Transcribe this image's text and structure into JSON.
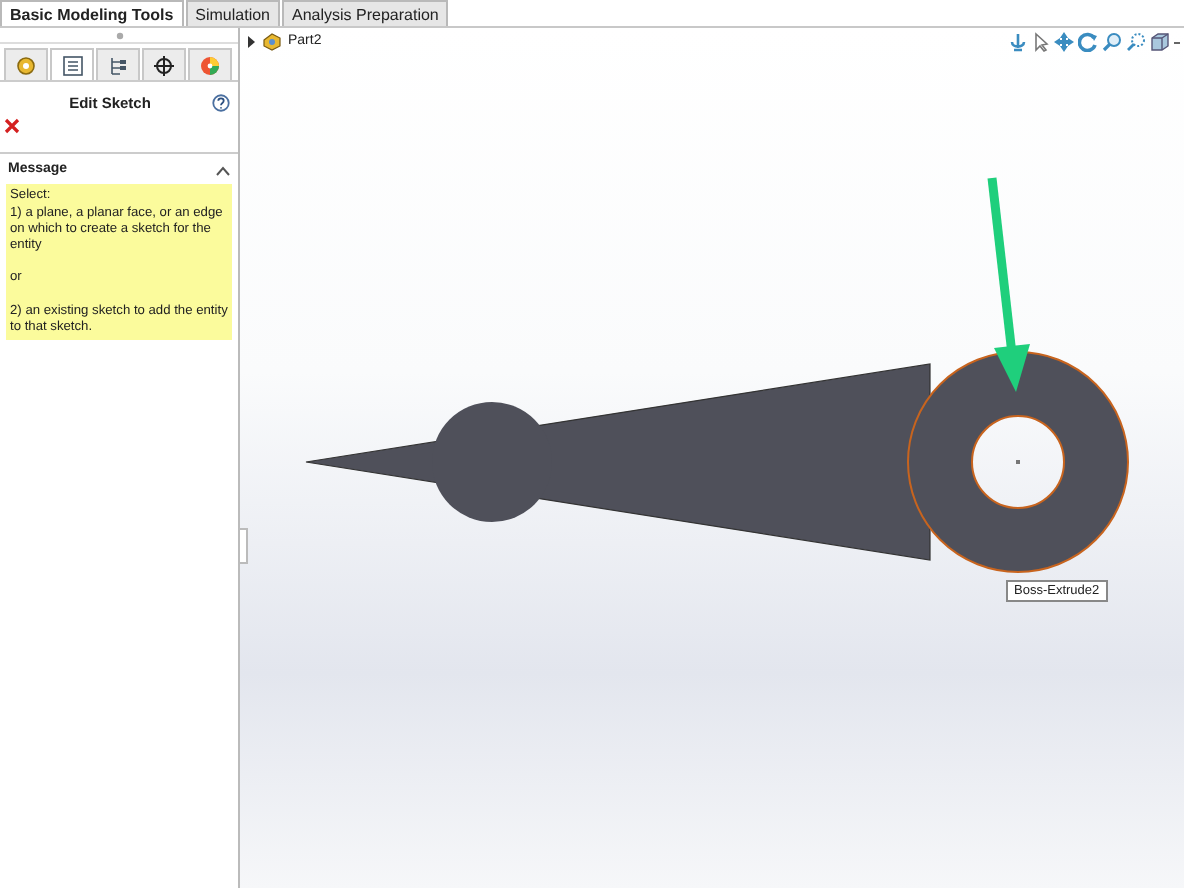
{
  "tabs": [
    {
      "label": "Basic Modeling Tools",
      "selected": true
    },
    {
      "label": "Simulation",
      "selected": false
    },
    {
      "label": "Analysis Preparation",
      "selected": false
    }
  ],
  "panel": {
    "tabs": [
      {
        "selected": false
      },
      {
        "selected": true
      },
      {
        "selected": false
      },
      {
        "selected": false
      },
      {
        "selected": false
      }
    ],
    "title": "Edit Sketch",
    "message": {
      "heading": "Message",
      "expanded": true,
      "paragraphs": [
        "Select:\n1) a plane, a planar face, or an edge on which to create a sketch for the entity",
        "or",
        "2) an existing sketch to add the entity to that sketch."
      ]
    }
  },
  "tree": {
    "items": [
      {
        "label": "Part2",
        "expanded": false
      }
    ]
  },
  "tooltip": "Boss-Extrude2"
}
